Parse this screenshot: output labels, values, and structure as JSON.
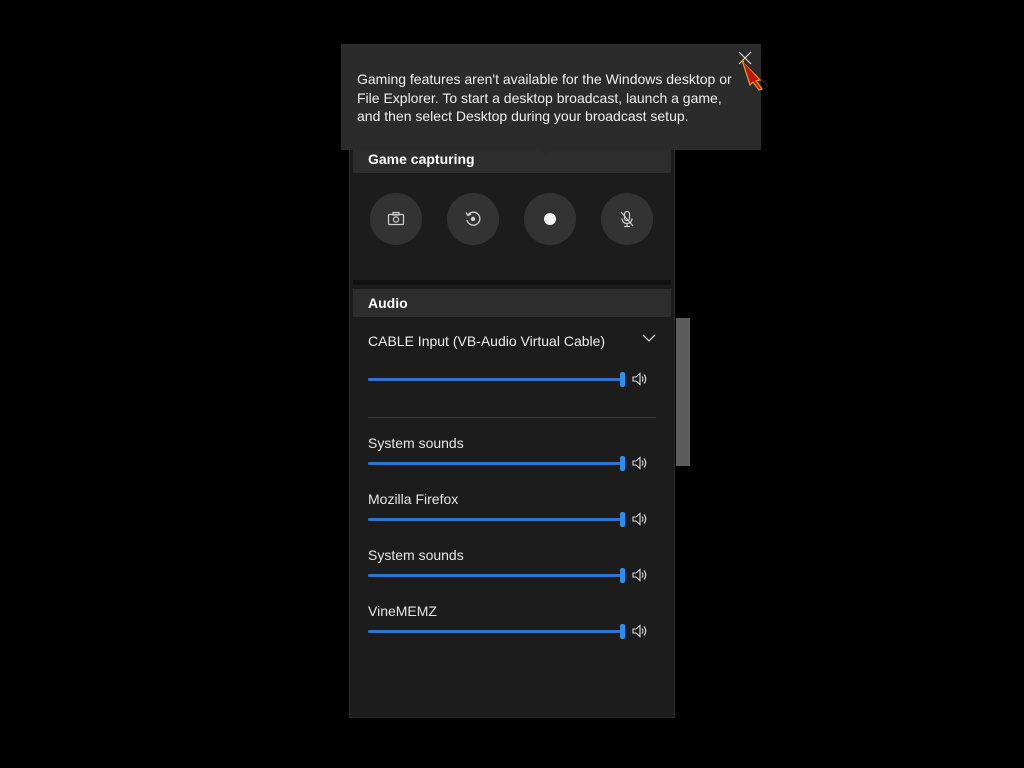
{
  "tooltip": {
    "message": "Gaming features aren't available for the Windows desktop or File Explorer. To start a desktop broadcast, launch a game, and then select Desktop during your broadcast setup.",
    "close_icon": "close-icon"
  },
  "capture": {
    "header": "Game capturing",
    "buttons": [
      {
        "icon": "camera-icon"
      },
      {
        "icon": "record-last-icon"
      },
      {
        "icon": "record-dot-icon"
      },
      {
        "icon": "mic-off-icon"
      }
    ]
  },
  "audio": {
    "header": "Audio",
    "device": "CABLE Input (VB-Audio Virtual Cable)",
    "master_volume": 1.0,
    "apps": [
      {
        "label": "System sounds",
        "volume": 1.0
      },
      {
        "label": "Mozilla Firefox",
        "volume": 1.0
      },
      {
        "label": "System sounds",
        "volume": 1.0
      },
      {
        "label": "VineMEMZ",
        "volume": 1.0
      }
    ]
  },
  "colors": {
    "accent": "#2f8fe8",
    "panel_bg": "#1c1c1c",
    "header_bg": "#2d2d2d",
    "tooltip_bg": "#2b2b2b"
  }
}
